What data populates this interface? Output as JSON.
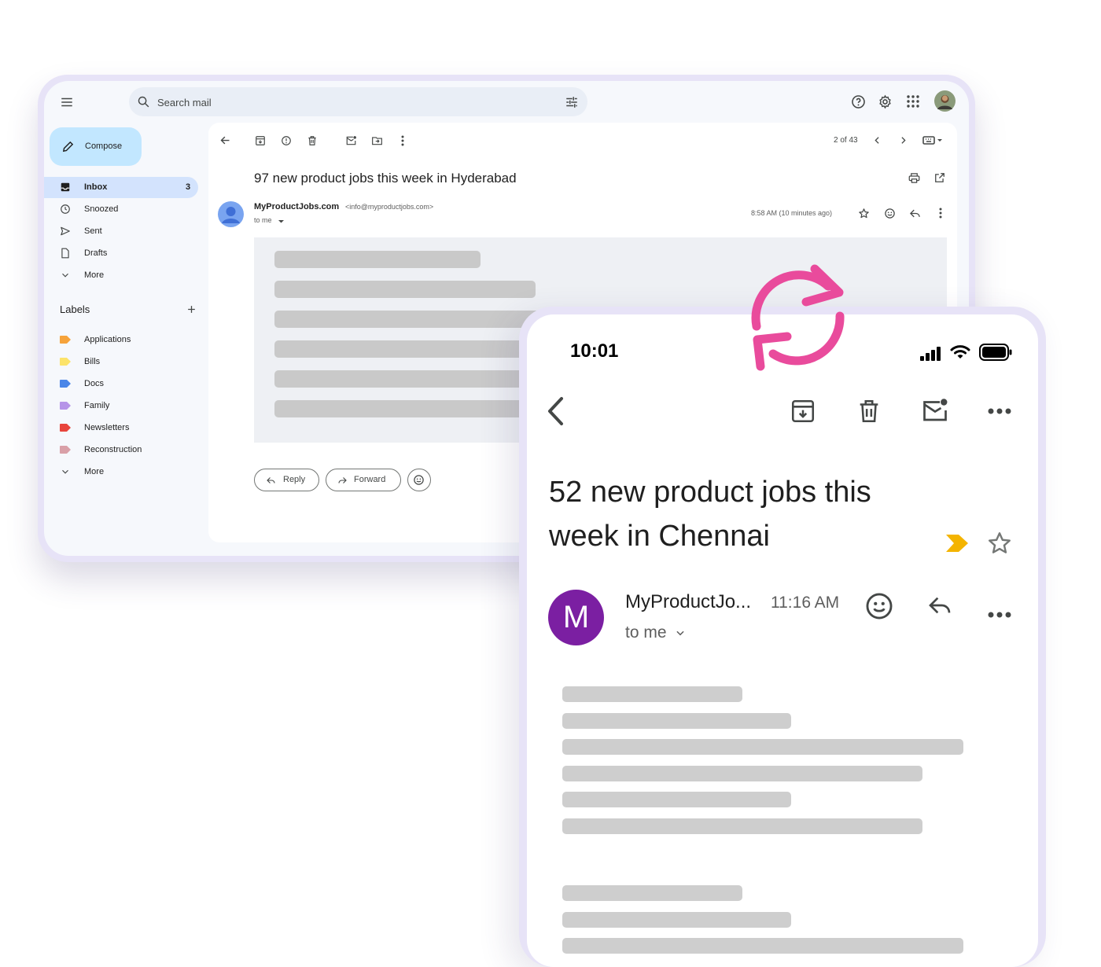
{
  "desktop": {
    "search": {
      "placeholder": "Search mail"
    },
    "compose_label": "Compose",
    "nav": [
      {
        "label": "Inbox",
        "count": "3"
      },
      {
        "label": "Snoozed"
      },
      {
        "label": "Sent"
      },
      {
        "label": "Drafts"
      },
      {
        "label": "More"
      }
    ],
    "labels_heading": "Labels",
    "labels": [
      {
        "label": "Applications",
        "color": "#f6a33b"
      },
      {
        "label": "Bills",
        "color": "#fce36a"
      },
      {
        "label": "Docs",
        "color": "#4a86e8"
      },
      {
        "label": "Family",
        "color": "#b694e8"
      },
      {
        "label": "Newsletters",
        "color": "#e8453c"
      },
      {
        "label": "Reconstruction",
        "color": "#d9a0a8"
      }
    ],
    "labels_more": "More",
    "pager": "2 of 43",
    "email": {
      "subject": "97 new product jobs this week in Hyderabad",
      "sender_name": "MyProductJobs.com",
      "sender_email": "<info@myproductjobs.com>",
      "recipient": "to me",
      "time": "8:58 AM (10 minutes ago)"
    },
    "reply_label": "Reply",
    "forward_label": "Forward"
  },
  "phone": {
    "status_time": "10:01",
    "email": {
      "subject": "52 new product jobs this week in Chennai",
      "avatar_letter": "M",
      "sender": "MyProductJo...",
      "time": "11:16 AM",
      "recipient": "to me"
    }
  },
  "colors": {
    "accent_pink": "#e94b9c",
    "compose_bg": "#c2e7ff",
    "inbox_active_bg": "#d3e3fd",
    "avatar_purple": "#7b1fa2",
    "importance_marker": "#f4b400"
  }
}
